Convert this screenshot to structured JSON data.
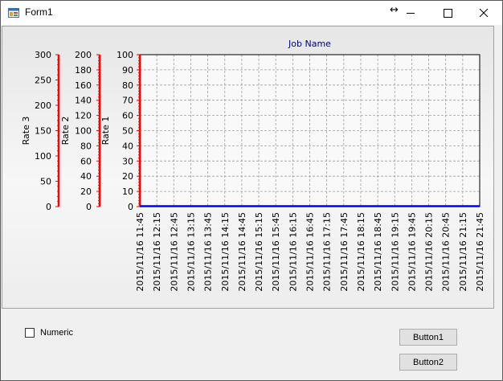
{
  "window": {
    "title": "Form1",
    "resize_glyph": "↔"
  },
  "colors": {
    "axis_red": "#ff0000",
    "series_blue": "#0000ff",
    "title_navy": "#000080"
  },
  "chart_data": {
    "type": "line",
    "title": "Job Name",
    "x_labels": [
      "2015/11/16 11:45",
      "2015/11/16 12:15",
      "2015/11/16 12:45",
      "2015/11/16 13:15",
      "2015/11/16 13:45",
      "2015/11/16 14:15",
      "2015/11/16 14:45",
      "2015/11/16 15:15",
      "2015/11/16 15:45",
      "2015/11/16 16:15",
      "2015/11/16 16:45",
      "2015/11/16 17:15",
      "2015/11/16 17:45",
      "2015/11/16 18:15",
      "2015/11/16 18:45",
      "2015/11/16 19:15",
      "2015/11/16 19:45",
      "2015/11/16 20:15",
      "2015/11/16 20:45",
      "2015/11/16 21:15",
      "2015/11/16 21:45"
    ],
    "axes": [
      {
        "label": "Rate 1",
        "range": [
          0,
          100
        ],
        "ticks": [
          0,
          10,
          20,
          30,
          40,
          50,
          60,
          70,
          80,
          90,
          100
        ]
      },
      {
        "label": "Rate 2",
        "range": [
          0,
          200
        ],
        "ticks": [
          0,
          20,
          40,
          60,
          80,
          100,
          120,
          140,
          160,
          180,
          200
        ]
      },
      {
        "label": "Rate 3",
        "range": [
          0,
          300
        ],
        "ticks": [
          0,
          50,
          100,
          150,
          200,
          250,
          300
        ]
      }
    ],
    "series": [
      {
        "values": [
          0,
          0,
          0,
          0,
          0,
          0,
          0,
          0,
          0,
          0,
          0,
          0,
          0,
          0,
          0,
          0,
          0,
          0,
          0,
          0,
          0
        ]
      }
    ],
    "grid": true
  },
  "controls": {
    "checkbox_label": "Numeric",
    "checkbox_checked": false,
    "button1": "Button1",
    "button2": "Button2"
  }
}
